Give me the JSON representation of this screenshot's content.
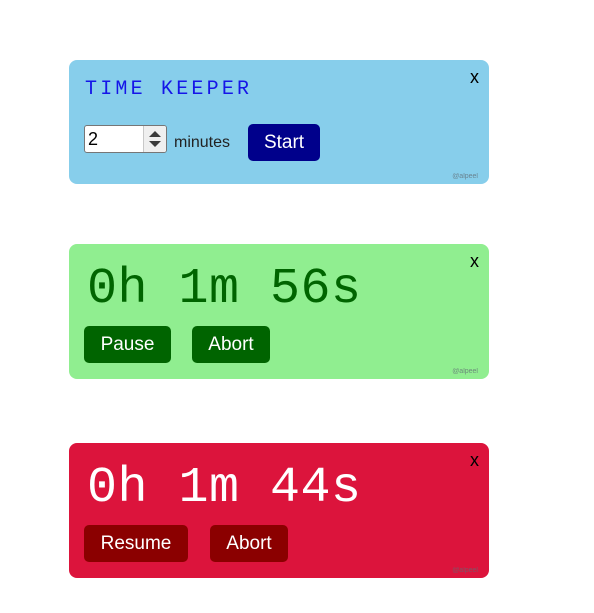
{
  "setup": {
    "title": "TIME KEEPER",
    "close_label": "x",
    "minutes_value": "2",
    "minutes_unit": "minutes",
    "start_label": "Start",
    "credit": "@alpeel",
    "bg_color": "#87ceeb",
    "title_color": "#1515e8",
    "button_color": "#00008b"
  },
  "running_timer": {
    "time": "0h 1m 56s",
    "close_label": "x",
    "pause_label": "Pause",
    "abort_label": "Abort",
    "credit": "@alpeel",
    "bg_color": "#90ee90",
    "accent_color": "#006400"
  },
  "paused_timer": {
    "time": "0h 1m 44s",
    "close_label": "x",
    "resume_label": "Resume",
    "abort_label": "Abort",
    "credit": "@alpeel",
    "bg_color": "#dc143c",
    "accent_color": "#8b0000"
  }
}
